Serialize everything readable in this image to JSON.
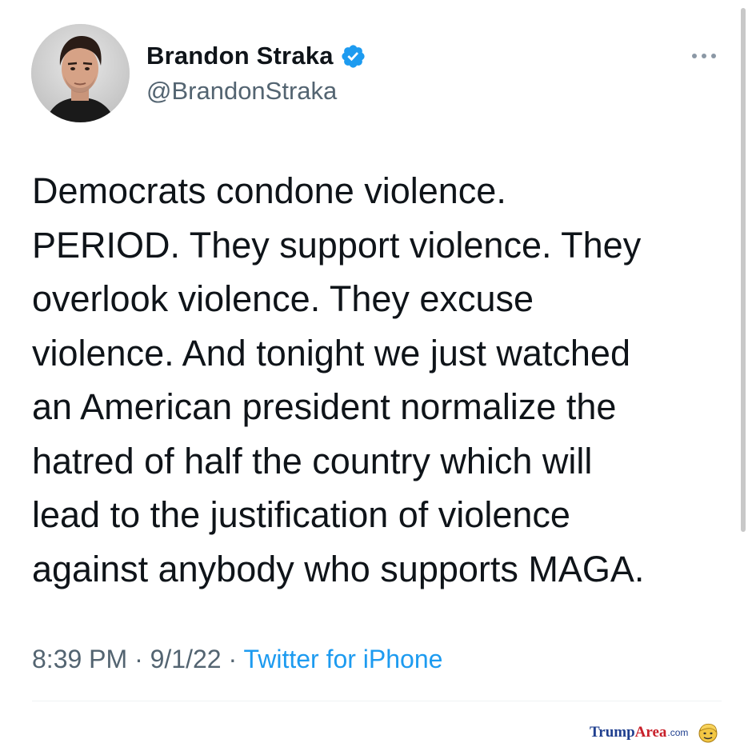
{
  "tweet": {
    "author": {
      "display_name": "Brandon Straka",
      "handle": "@BrandonStraka",
      "verified": true,
      "avatar_icon": "profile-photo",
      "verified_icon": "verified-badge-icon"
    },
    "more_icon": "more-options-icon",
    "text": "Democrats condone violence.\nPERIOD. They support violence. They\noverlook violence. They excuse\nviolence. And tonight we just watched\nan American president normalize the\nhatred of half the country which will\nlead to the justification of violence\nagainst anybody who supports MAGA.",
    "time": "8:39 PM",
    "separator": " · ",
    "date": "9/1/22",
    "source": "Twitter for iPhone"
  },
  "watermark": {
    "brand_part1": "Trump",
    "brand_part2": "Area",
    "brand_suffix": ".com",
    "logo_icon": "trump-face-icon"
  },
  "colors": {
    "text_primary": "#0f1419",
    "text_secondary": "#536471",
    "link": "#1d9bf0",
    "verified": "#1d9bf0"
  }
}
